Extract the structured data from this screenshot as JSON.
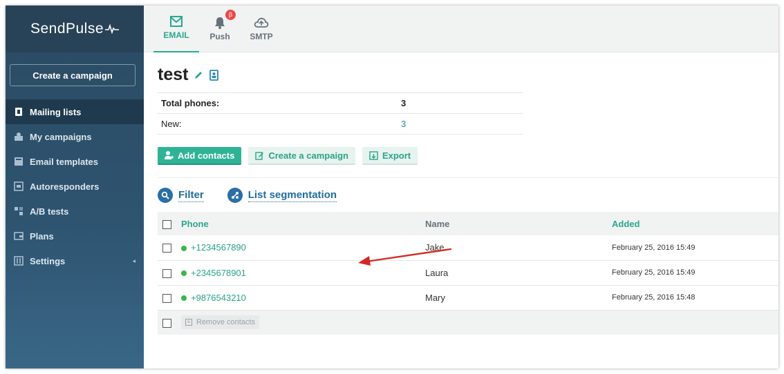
{
  "brand": {
    "name": "SendPulse",
    "wave": "╱╲"
  },
  "sidebar": {
    "create_button": "Create a campaign",
    "items": [
      {
        "label": "Mailing lists",
        "icon": "book-icon",
        "active": true
      },
      {
        "label": "My campaigns",
        "icon": "campaigns-icon"
      },
      {
        "label": "Email templates",
        "icon": "template-icon"
      },
      {
        "label": "Autoresponders",
        "icon": "autoresponder-icon"
      },
      {
        "label": "A/B tests",
        "icon": "ab-test-icon"
      },
      {
        "label": "Plans",
        "icon": "wallet-icon"
      },
      {
        "label": "Settings",
        "icon": "settings-icon",
        "caret": "◂"
      }
    ]
  },
  "tabs": [
    {
      "label": "EMAIL",
      "icon": "envelope-icon",
      "active": true
    },
    {
      "label": "Push",
      "icon": "bell-icon",
      "badge": "β"
    },
    {
      "label": "SMTP",
      "icon": "cloud-icon"
    }
  ],
  "list": {
    "title": "test",
    "stats": [
      {
        "label": "Total phones:",
        "value": "3"
      },
      {
        "label": "New:",
        "value": "3"
      }
    ],
    "actions": {
      "add_contacts": "Add contacts",
      "create_campaign": "Create a campaign",
      "export": "Export"
    },
    "filter_label": "Filter",
    "segmentation_label": "List segmentation"
  },
  "table": {
    "columns": {
      "phone": "Phone",
      "name": "Name",
      "added": "Added"
    },
    "rows": [
      {
        "phone": "+1234567890",
        "name": "Jake",
        "added": "February 25, 2016 15:49"
      },
      {
        "phone": "+2345678901",
        "name": "Laura",
        "added": "February 25, 2016 15:49"
      },
      {
        "phone": "+9876543210",
        "name": "Mary",
        "added": "February 25, 2016 15:48"
      }
    ],
    "remove_button": "Remove contacts"
  },
  "colors": {
    "accent": "#27a88e",
    "link": "#2a89b5",
    "sidebar": "#2e5470",
    "status_active": "#3cb54a",
    "badge": "#ec4a47",
    "arrow": "#d42a25"
  }
}
